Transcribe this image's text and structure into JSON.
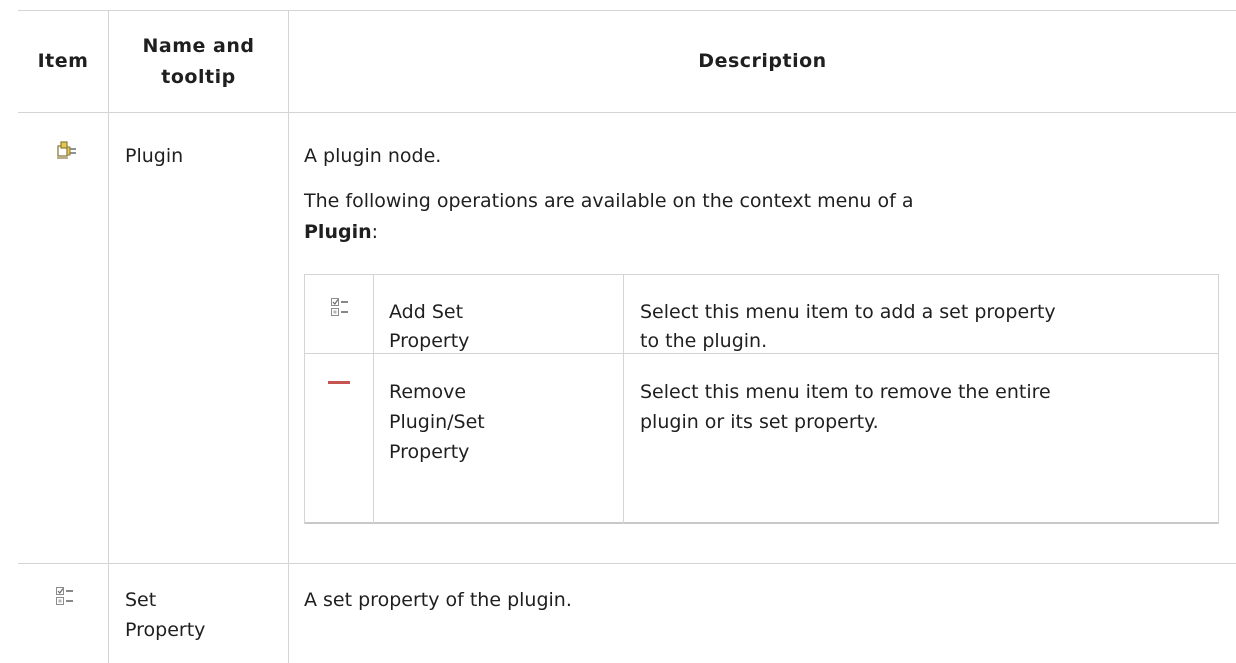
{
  "table": {
    "headers": {
      "item": "Item",
      "name_line1": "Name and",
      "name_line2": "tooltip",
      "description": "Description"
    },
    "rows": [
      {
        "icon": "plugin-icon",
        "name": "Plugin",
        "desc_line1": "A plugin node.",
        "desc_line2": "The following operations are available on the context menu of a",
        "desc_line3_bold": "Plugin",
        "desc_line3_suffix": ":",
        "nested": [
          {
            "icon": "add-set-property-icon",
            "name_line1": "Add Set",
            "name_line2": "Property",
            "desc_line1": "Select this menu item to add a set property",
            "desc_line2": "to the plugin."
          },
          {
            "icon": "remove-icon",
            "name_line1": "Remove",
            "name_line2": "Plugin/Set",
            "name_line3": "Property",
            "desc_line1": "Select this menu item to remove the entire",
            "desc_line2": "plugin or its set property."
          }
        ]
      },
      {
        "icon": "set-property-icon",
        "name_line1": "Set",
        "name_line2": "Property",
        "desc_line1": "A set property of the plugin."
      }
    ]
  },
  "colors": {
    "border": "#d4d4d4",
    "remove_icon": "#c75450",
    "plugin_icon": "#b39a3a"
  }
}
